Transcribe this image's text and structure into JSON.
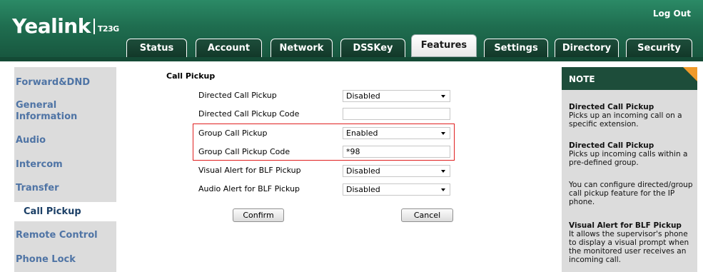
{
  "header": {
    "brand": "Yealink",
    "model": "T23G",
    "logout": "Log Out"
  },
  "tabs": [
    {
      "label": "Status"
    },
    {
      "label": "Account"
    },
    {
      "label": "Network"
    },
    {
      "label": "DSSKey"
    },
    {
      "label": "Features",
      "active": true
    },
    {
      "label": "Settings"
    },
    {
      "label": "Directory"
    },
    {
      "label": "Security"
    }
  ],
  "sidebar": {
    "items": [
      {
        "label": "Forward&DND"
      },
      {
        "label": "General Information"
      },
      {
        "label": "Audio"
      },
      {
        "label": "Intercom"
      },
      {
        "label": "Transfer"
      },
      {
        "label": "Call Pickup",
        "active": true
      },
      {
        "label": "Remote Control"
      },
      {
        "label": "Phone Lock"
      }
    ]
  },
  "form": {
    "section_title": "Call Pickup",
    "rows": [
      {
        "label": "Directed Call Pickup",
        "value": "Disabled",
        "type": "select"
      },
      {
        "label": "Directed Call Pickup Code",
        "value": "",
        "type": "input"
      },
      {
        "label": "Group Call Pickup",
        "value": "Enabled",
        "type": "select"
      },
      {
        "label": "Group Call Pickup Code",
        "value": "*98",
        "type": "input"
      },
      {
        "label": "Visual Alert for BLF Pickup",
        "value": "Disabled",
        "type": "select"
      },
      {
        "label": "Audio Alert for BLF Pickup",
        "value": "Disabled",
        "type": "select"
      }
    ],
    "confirm": "Confirm",
    "cancel": "Cancel"
  },
  "note": {
    "title": "NOTE",
    "blocks": [
      {
        "heading": "Directed Call Pickup",
        "text": "Picks up an incoming call on a specific extension."
      },
      {
        "heading": "Directed Call Pickup",
        "text": "Picks up incoming calls within a pre-defined group."
      },
      {
        "heading": "",
        "text": "You can configure directed/group call pickup feature for the IP phone."
      },
      {
        "heading": "Visual Alert for BLF Pickup",
        "text": "It allows the supervisor's phone to display a visual prompt when the monitored user receives an incoming call."
      }
    ]
  },
  "colors": {
    "header_green": "#1f6e50",
    "tab_dark": "#123829",
    "sidebar_link": "#4f74a5",
    "highlight_red": "#e02020",
    "note_corner": "#f09a2a"
  }
}
